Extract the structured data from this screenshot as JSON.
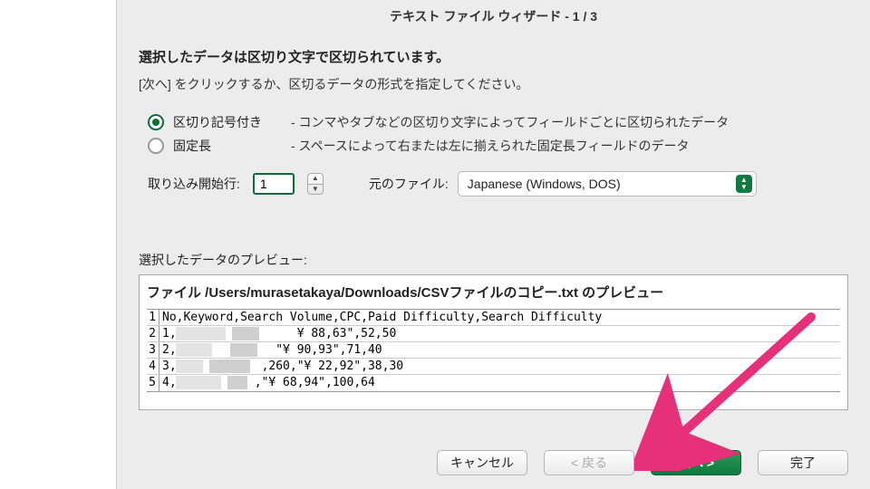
{
  "title": "テキスト ファイル ウィザード - 1 / 3",
  "heading": "選択したデータは区切り文字で区切られています。",
  "subheading": "[次へ] をクリックするか、区切るデータの形式を指定してください。",
  "options": {
    "delimited": {
      "label": "区切り記号付き",
      "desc": "- コンマやタブなどの区切り文字によってフィールドごとに区切られたデータ"
    },
    "fixed": {
      "label": "固定長",
      "desc": "- スペースによって右または左に揃えられた固定長フィールドのデータ"
    },
    "selected": "delimited"
  },
  "start_row": {
    "label": "取り込み開始行:",
    "value": "1"
  },
  "encoding": {
    "label": "元のファイル:",
    "value": "Japanese (Windows, DOS)"
  },
  "preview": {
    "label": "選択したデータのプレビュー:",
    "file_line": "ファイル /Users/murasetakaya/Downloads/CSVファイルのコピー.txt のプレビュー",
    "rows": [
      {
        "n": "1",
        "text": "No,Keyword,Search Volume,CPC,Paid Difficulty,Search Difficulty"
      },
      {
        "n": "2",
        "text": "1,                 ¥ 88,63\",52,50"
      },
      {
        "n": "3",
        "text": "2,              \"¥ 90,93\",71,40"
      },
      {
        "n": "4",
        "text": "3,            ,260,\"¥ 22,92\",38,30"
      },
      {
        "n": "5",
        "text": "4,           ,\"¥ 68,94\",100,64"
      }
    ]
  },
  "buttons": {
    "cancel": "キャンセル",
    "back": "< 戻る",
    "next": "次へ >",
    "finish": "完了"
  }
}
